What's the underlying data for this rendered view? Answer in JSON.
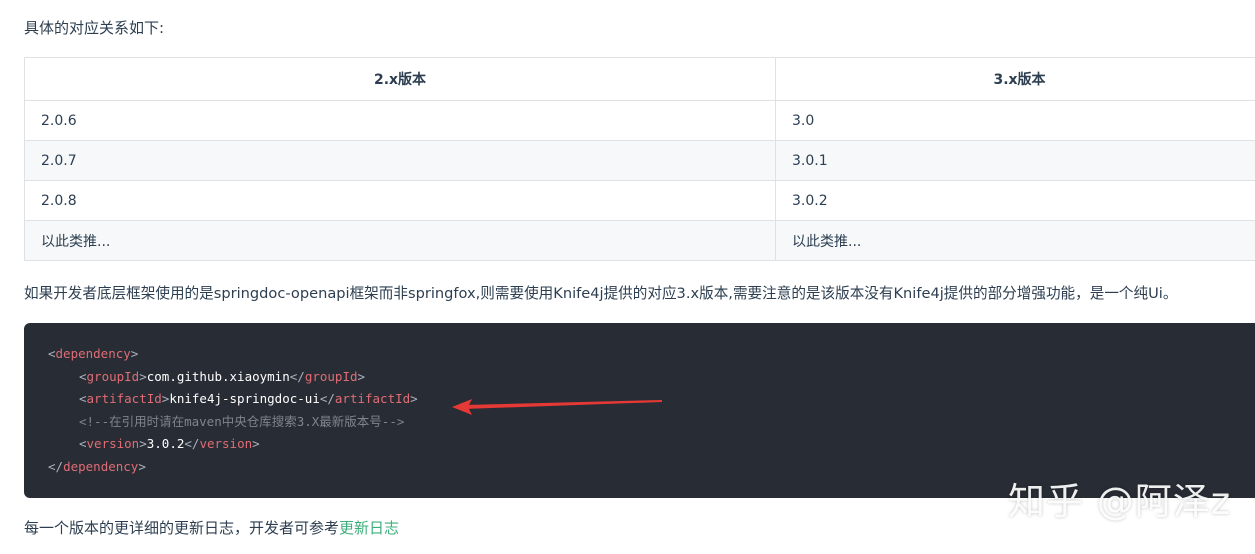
{
  "intro": "具体的对应关系如下:",
  "table": {
    "headers": [
      "2.x版本",
      "3.x版本"
    ],
    "rows": [
      [
        "2.0.6",
        "3.0"
      ],
      [
        "2.0.7",
        "3.0.1"
      ],
      [
        "2.0.8",
        "3.0.2"
      ],
      [
        "以此类推...",
        "以此类推..."
      ]
    ]
  },
  "paragraph": "如果开发者底层框架使用的是springdoc-openapi框架而非springfox,则需要使用Knife4j提供的对应3.x版本,需要注意的是该版本没有Knife4j提供的部分增强功能，是一个纯Ui。",
  "code": {
    "lt": "<",
    "gt": ">",
    "lt_slash": "</",
    "dependency": "dependency",
    "groupId_tag": "groupId",
    "groupId_value": "com.github.xiaoymin",
    "artifactId_tag": "artifactId",
    "artifactId_value": "knife4j-springdoc-ui",
    "comment": "<!--在引用时请在maven中央仓库搜索3.X最新版本号-->",
    "version_tag": "version",
    "version_value": "3.0.2"
  },
  "footer": {
    "text": "每一个版本的更详细的更新日志，开发者可参考",
    "link": "更新日志"
  },
  "watermark": "知乎 @阿泽z",
  "colors": {
    "accent_link": "#3eaf7c",
    "code_bg": "#282c34",
    "code_tag": "#e06c75",
    "arrow": "#e53935"
  }
}
